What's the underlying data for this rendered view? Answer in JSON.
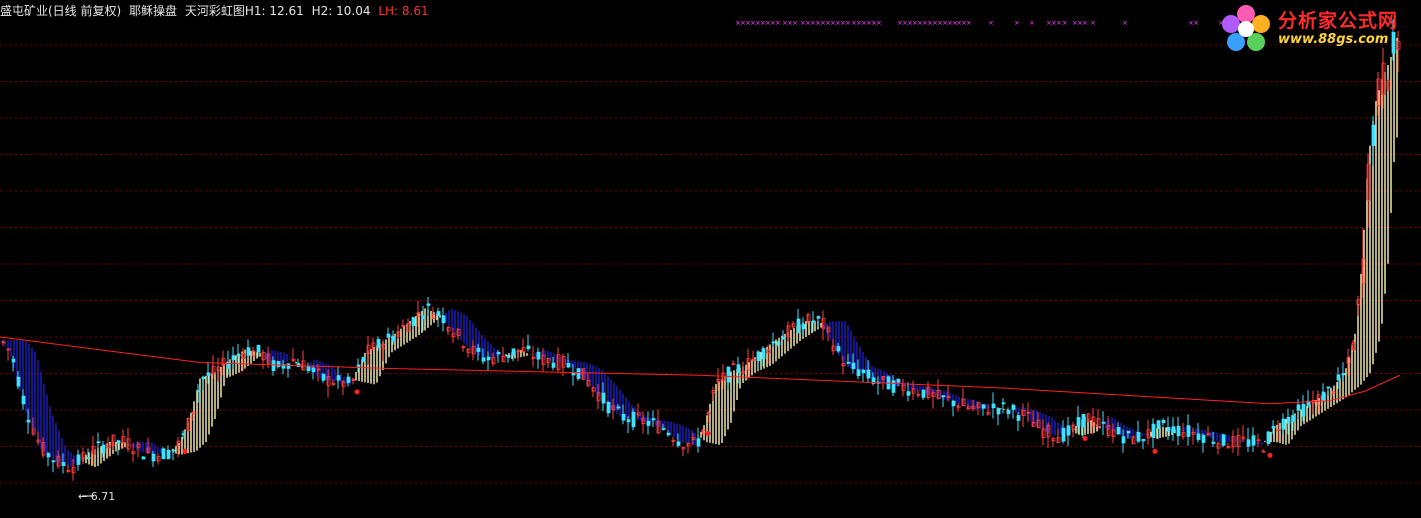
{
  "header": {
    "stock_name": "盛屯矿业(日线 前复权)",
    "indicator_1": "耶稣操盘",
    "indicator_2": "天河彩虹图",
    "h1_label": "H1:",
    "h1_value": "12.61",
    "h2_label": "H2:",
    "h2_value": "10.04",
    "lh_label": "LH:",
    "lh_value": "8.61"
  },
  "logo": {
    "title": "分析家公式网",
    "url": "www.88gs.com"
  },
  "annotations": {
    "min_price_label": "6.71"
  },
  "colors": {
    "background": "#000000",
    "grid": "#7a0000",
    "candle_up": "#ff4040",
    "candle_down": "#40e0ff",
    "band_up": "#fff7b0",
    "band_down": "#2020c8",
    "long_ma": "#ff2020",
    "signal_marks": "#ff40ff",
    "signal_dot": "#ff2020"
  },
  "chart_data": {
    "type": "candlestick",
    "title": "",
    "xlabel": "",
    "ylabel": "",
    "ylim": [
      6.5,
      14.2
    ],
    "grid": true,
    "legend": "none",
    "min_low": 6.71,
    "overlays": [
      "short_ma_band",
      "long_ma"
    ],
    "price_path": [
      [
        0,
        9.2
      ],
      [
        10,
        9.0
      ],
      [
        25,
        8.1
      ],
      [
        40,
        7.5
      ],
      [
        55,
        7.3
      ],
      [
        70,
        7.2
      ],
      [
        90,
        7.45
      ],
      [
        110,
        7.6
      ],
      [
        125,
        7.6
      ],
      [
        140,
        7.45
      ],
      [
        155,
        7.4
      ],
      [
        170,
        7.45
      ],
      [
        180,
        7.6
      ],
      [
        190,
        8.0
      ],
      [
        200,
        8.6
      ],
      [
        215,
        8.7
      ],
      [
        230,
        8.9
      ],
      [
        245,
        9.05
      ],
      [
        260,
        9.0
      ],
      [
        275,
        8.75
      ],
      [
        290,
        8.9
      ],
      [
        305,
        8.8
      ],
      [
        320,
        8.6
      ],
      [
        335,
        8.55
      ],
      [
        350,
        8.5
      ],
      [
        365,
        9.0
      ],
      [
        380,
        9.15
      ],
      [
        395,
        9.3
      ],
      [
        410,
        9.5
      ],
      [
        425,
        9.7
      ],
      [
        440,
        9.6
      ],
      [
        455,
        9.3
      ],
      [
        470,
        9.05
      ],
      [
        485,
        8.9
      ],
      [
        500,
        8.95
      ],
      [
        520,
        9.05
      ],
      [
        540,
        8.9
      ],
      [
        560,
        8.85
      ],
      [
        575,
        8.75
      ],
      [
        590,
        8.5
      ],
      [
        605,
        8.2
      ],
      [
        620,
        8.0
      ],
      [
        635,
        7.95
      ],
      [
        650,
        7.9
      ],
      [
        665,
        7.8
      ],
      [
        680,
        7.6
      ],
      [
        695,
        7.55
      ],
      [
        705,
        7.9
      ],
      [
        715,
        8.5
      ],
      [
        730,
        8.7
      ],
      [
        745,
        8.8
      ],
      [
        760,
        9.0
      ],
      [
        775,
        9.2
      ],
      [
        790,
        9.35
      ],
      [
        805,
        9.5
      ],
      [
        820,
        9.5
      ],
      [
        830,
        9.2
      ],
      [
        845,
        8.8
      ],
      [
        860,
        8.7
      ],
      [
        875,
        8.55
      ],
      [
        890,
        8.5
      ],
      [
        905,
        8.45
      ],
      [
        920,
        8.4
      ],
      [
        935,
        8.3
      ],
      [
        950,
        8.25
      ],
      [
        965,
        8.15
      ],
      [
        980,
        8.1
      ],
      [
        995,
        8.15
      ],
      [
        1010,
        8.1
      ],
      [
        1025,
        8.0
      ],
      [
        1040,
        7.8
      ],
      [
        1055,
        7.7
      ],
      [
        1070,
        7.75
      ],
      [
        1085,
        8.0
      ],
      [
        1100,
        7.85
      ],
      [
        1115,
        7.75
      ],
      [
        1130,
        7.65
      ],
      [
        1145,
        7.7
      ],
      [
        1160,
        7.85
      ],
      [
        1175,
        7.8
      ],
      [
        1190,
        7.75
      ],
      [
        1205,
        7.7
      ],
      [
        1220,
        7.6
      ],
      [
        1235,
        7.6
      ],
      [
        1250,
        7.6
      ],
      [
        1262,
        7.55
      ],
      [
        1275,
        7.85
      ],
      [
        1290,
        8.0
      ],
      [
        1305,
        8.15
      ],
      [
        1320,
        8.3
      ],
      [
        1335,
        8.5
      ],
      [
        1345,
        8.7
      ],
      [
        1355,
        9.3
      ],
      [
        1362,
        10.4
      ],
      [
        1368,
        12.0
      ],
      [
        1375,
        12.9
      ],
      [
        1382,
        13.3
      ],
      [
        1390,
        13.6
      ],
      [
        1400,
        14.1
      ]
    ],
    "long_ma_path": [
      [
        0,
        9.25
      ],
      [
        200,
        8.85
      ],
      [
        400,
        8.75
      ],
      [
        700,
        8.65
      ],
      [
        1000,
        8.45
      ],
      [
        1270,
        8.2
      ],
      [
        1330,
        8.25
      ],
      [
        1365,
        8.4
      ],
      [
        1400,
        8.65
      ]
    ],
    "reference_levels": {
      "H1": 12.61,
      "H2": 10.04,
      "LH": 8.61
    }
  }
}
